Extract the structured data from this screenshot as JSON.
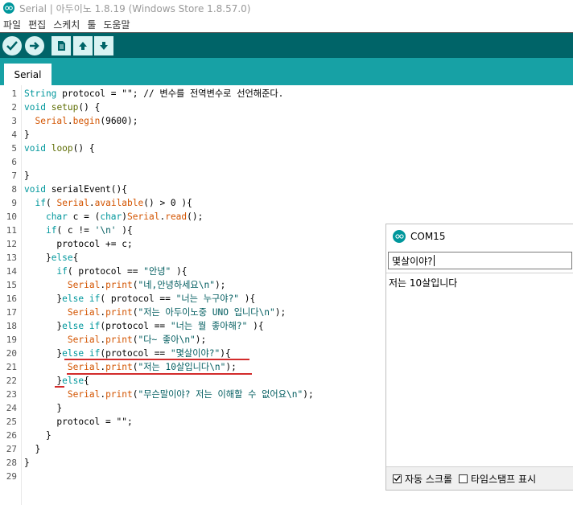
{
  "window": {
    "title": "Serial | 아두이노 1.8.19 (Windows Store 1.8.57.0)"
  },
  "menu": {
    "items": [
      "파일",
      "편집",
      "스케치",
      "툴",
      "도움말"
    ]
  },
  "toolbar": {
    "buttons": [
      "verify-icon",
      "upload-icon",
      "new-icon",
      "open-icon",
      "save-icon"
    ],
    "accent_color": "#006468",
    "tabbar_color": "#17a1a5"
  },
  "tabs": [
    {
      "label": "Serial"
    }
  ],
  "editor": {
    "line_numbers": [
      "1",
      "2",
      "3",
      "4",
      "5",
      "6",
      "7",
      "8",
      "9",
      "10",
      "11",
      "12",
      "13",
      "14",
      "15",
      "16",
      "17",
      "18",
      "19",
      "20",
      "21",
      "22",
      "23",
      "24",
      "25",
      "26",
      "27",
      "28",
      "29"
    ],
    "lines": [
      [
        {
          "t": "String",
          "c": "kw2"
        },
        {
          "t": " protocol = \"\"; // 변수를 전역변수로 선언해준다.",
          "c": "txt"
        }
      ],
      [
        {
          "t": "void",
          "c": "kw2"
        },
        {
          "t": " ",
          "c": "txt"
        },
        {
          "t": "setup",
          "c": "fn"
        },
        {
          "t": "() {",
          "c": "txt"
        }
      ],
      [
        {
          "t": "  ",
          "c": "txt"
        },
        {
          "t": "Serial",
          "c": "kw1"
        },
        {
          "t": ".",
          "c": "txt"
        },
        {
          "t": "begin",
          "c": "kw1"
        },
        {
          "t": "(9600);",
          "c": "txt"
        }
      ],
      [
        {
          "t": "}",
          "c": "txt"
        }
      ],
      [
        {
          "t": "void",
          "c": "kw2"
        },
        {
          "t": " ",
          "c": "txt"
        },
        {
          "t": "loop",
          "c": "fn"
        },
        {
          "t": "() {",
          "c": "txt"
        }
      ],
      [
        {
          "t": "",
          "c": "txt"
        }
      ],
      [
        {
          "t": "}",
          "c": "txt"
        }
      ],
      [
        {
          "t": "void",
          "c": "kw2"
        },
        {
          "t": " serialEvent(){",
          "c": "txt"
        }
      ],
      [
        {
          "t": "  ",
          "c": "txt"
        },
        {
          "t": "if",
          "c": "kw2"
        },
        {
          "t": "( ",
          "c": "txt"
        },
        {
          "t": "Serial",
          "c": "kw1"
        },
        {
          "t": ".",
          "c": "txt"
        },
        {
          "t": "available",
          "c": "kw1"
        },
        {
          "t": "() > 0 ){",
          "c": "txt"
        }
      ],
      [
        {
          "t": "    ",
          "c": "txt"
        },
        {
          "t": "char",
          "c": "kw2"
        },
        {
          "t": " c = (",
          "c": "txt"
        },
        {
          "t": "char",
          "c": "kw2"
        },
        {
          "t": ")",
          "c": "txt"
        },
        {
          "t": "Serial",
          "c": "kw1"
        },
        {
          "t": ".",
          "c": "txt"
        },
        {
          "t": "read",
          "c": "kw1"
        },
        {
          "t": "();",
          "c": "txt"
        }
      ],
      [
        {
          "t": "    ",
          "c": "txt"
        },
        {
          "t": "if",
          "c": "kw2"
        },
        {
          "t": "( c != ",
          "c": "txt"
        },
        {
          "t": "'\\n'",
          "c": "str"
        },
        {
          "t": " ){",
          "c": "txt"
        }
      ],
      [
        {
          "t": "      protocol += c;",
          "c": "txt"
        }
      ],
      [
        {
          "t": "    }",
          "c": "txt"
        },
        {
          "t": "else",
          "c": "kw2"
        },
        {
          "t": "{",
          "c": "txt"
        }
      ],
      [
        {
          "t": "      ",
          "c": "txt"
        },
        {
          "t": "if",
          "c": "kw2"
        },
        {
          "t": "( protocol == ",
          "c": "txt"
        },
        {
          "t": "\"안녕\"",
          "c": "str"
        },
        {
          "t": " ){",
          "c": "txt"
        }
      ],
      [
        {
          "t": "        ",
          "c": "txt"
        },
        {
          "t": "Serial",
          "c": "kw1"
        },
        {
          "t": ".",
          "c": "txt"
        },
        {
          "t": "print",
          "c": "kw1"
        },
        {
          "t": "(",
          "c": "txt"
        },
        {
          "t": "\"네,안녕하세요\\n\"",
          "c": "str"
        },
        {
          "t": ");",
          "c": "txt"
        }
      ],
      [
        {
          "t": "      }",
          "c": "txt"
        },
        {
          "t": "else",
          "c": "kw2"
        },
        {
          "t": " ",
          "c": "txt"
        },
        {
          "t": "if",
          "c": "kw2"
        },
        {
          "t": "( protocol == ",
          "c": "txt"
        },
        {
          "t": "\"너는 누구야?\"",
          "c": "str"
        },
        {
          "t": " ){",
          "c": "txt"
        }
      ],
      [
        {
          "t": "        ",
          "c": "txt"
        },
        {
          "t": "Serial",
          "c": "kw1"
        },
        {
          "t": ".",
          "c": "txt"
        },
        {
          "t": "print",
          "c": "kw1"
        },
        {
          "t": "(",
          "c": "txt"
        },
        {
          "t": "\"저는 아두이노중 UNO 입니다\\n\"",
          "c": "str"
        },
        {
          "t": ");",
          "c": "txt"
        }
      ],
      [
        {
          "t": "      }",
          "c": "txt"
        },
        {
          "t": "else",
          "c": "kw2"
        },
        {
          "t": " ",
          "c": "txt"
        },
        {
          "t": "if",
          "c": "kw2"
        },
        {
          "t": "(protocol == ",
          "c": "txt"
        },
        {
          "t": "\"너는 뭘 좋아해?\"",
          "c": "str"
        },
        {
          "t": " ){",
          "c": "txt"
        }
      ],
      [
        {
          "t": "        ",
          "c": "txt"
        },
        {
          "t": "Serial",
          "c": "kw1"
        },
        {
          "t": ".",
          "c": "txt"
        },
        {
          "t": "print",
          "c": "kw1"
        },
        {
          "t": "(",
          "c": "txt"
        },
        {
          "t": "\"다~ 좋아\\n\"",
          "c": "str"
        },
        {
          "t": ");",
          "c": "txt"
        }
      ],
      [
        {
          "t": "      }",
          "c": "txt"
        },
        {
          "t": "else",
          "c": "kw2"
        },
        {
          "t": " ",
          "c": "txt"
        },
        {
          "t": "if",
          "c": "kw2"
        },
        {
          "t": "(protocol == ",
          "c": "txt"
        },
        {
          "t": "\"몇살이야?\"",
          "c": "str"
        },
        {
          "t": "){",
          "c": "txt"
        }
      ],
      [
        {
          "t": "        ",
          "c": "txt"
        },
        {
          "t": "Serial",
          "c": "kw1"
        },
        {
          "t": ".",
          "c": "txt"
        },
        {
          "t": "print",
          "c": "kw1"
        },
        {
          "t": "(",
          "c": "txt"
        },
        {
          "t": "\"저는 10살입니다\\n\"",
          "c": "str"
        },
        {
          "t": ");",
          "c": "txt"
        }
      ],
      [
        {
          "t": "      }",
          "c": "txt"
        },
        {
          "t": "else",
          "c": "kw2"
        },
        {
          "t": "{",
          "c": "txt"
        }
      ],
      [
        {
          "t": "        ",
          "c": "txt"
        },
        {
          "t": "Serial",
          "c": "kw1"
        },
        {
          "t": ".",
          "c": "txt"
        },
        {
          "t": "print",
          "c": "kw1"
        },
        {
          "t": "(",
          "c": "txt"
        },
        {
          "t": "\"무슨말이야? 저는 이해할 수 없어요\\n\"",
          "c": "str"
        },
        {
          "t": ");",
          "c": "txt"
        }
      ],
      [
        {
          "t": "      }",
          "c": "txt"
        }
      ],
      [
        {
          "t": "      protocol = \"\";",
          "c": "txt"
        }
      ],
      [
        {
          "t": "    }",
          "c": "txt"
        }
      ],
      [
        {
          "t": "  }",
          "c": "txt"
        }
      ],
      [
        {
          "t": "}",
          "c": "txt"
        }
      ],
      [
        {
          "t": "",
          "c": "txt"
        }
      ]
    ],
    "colors": {
      "kw1": "#d35400",
      "kw2": "#00979c",
      "fn": "#5e6d03",
      "str": "#005c5f",
      "txt": "#000000",
      "annotation": "#d32b2b"
    }
  },
  "serial_monitor": {
    "title": "COM15",
    "input_value": "몇살이야?",
    "output": "저는 10살입니다",
    "autoscroll_label": "자동 스크롤",
    "autoscroll_checked": true,
    "timestamp_label": "타임스탬프 표시",
    "timestamp_checked": false
  }
}
